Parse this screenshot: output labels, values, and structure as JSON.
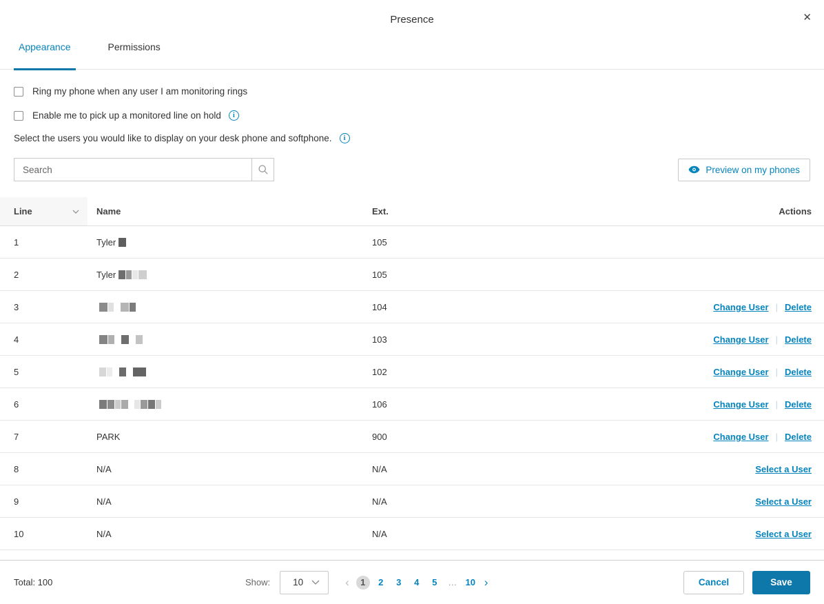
{
  "dialog": {
    "title": "Presence",
    "close_glyph": "✕"
  },
  "tabs": [
    {
      "label": "Appearance",
      "active": true
    },
    {
      "label": "Permissions",
      "active": false
    }
  ],
  "options": {
    "ring_checkbox_label": "Ring my phone when any user I am monitoring rings",
    "pickup_checkbox_label": "Enable me to pick up a monitored line on hold",
    "select_users_text": "Select the users you would like to display on your desk phone and softphone.",
    "info_glyph": "i"
  },
  "search": {
    "placeholder": "Search"
  },
  "preview_button_label": "Preview on my phones",
  "table": {
    "headers": {
      "line": "Line",
      "name": "Name",
      "ext": "Ext.",
      "actions": "Actions"
    },
    "rows": [
      {
        "line": "1",
        "name": "Tyler",
        "redaction": [
          [
            11,
            "#5f5f5f"
          ]
        ],
        "ext": "105",
        "actions": []
      },
      {
        "line": "2",
        "name": "Tyler",
        "redaction": [
          [
            10,
            "#6e6e6e"
          ],
          [
            8,
            "#9a9a9a"
          ],
          [
            8,
            "#e8e8e8"
          ],
          [
            12,
            "#cfcfcf"
          ]
        ],
        "ext": "105",
        "actions": []
      },
      {
        "line": "3",
        "name": "",
        "redaction": [
          [
            12,
            "#8b8b8b"
          ],
          [
            8,
            "#e0e0e0"
          ],
          [
            8,
            ""
          ],
          [
            12,
            "#b5b5b5"
          ],
          [
            9,
            "#7c7c7c"
          ]
        ],
        "ext": "104",
        "actions": [
          "Change User",
          "Delete"
        ]
      },
      {
        "line": "4",
        "name": "",
        "redaction": [
          [
            12,
            "#848484"
          ],
          [
            9,
            "#b0b0b0"
          ],
          [
            8,
            ""
          ],
          [
            11,
            "#6e6e6e"
          ],
          [
            8,
            ""
          ],
          [
            10,
            "#c3c3c3"
          ]
        ],
        "ext": "103",
        "actions": [
          "Change User",
          "Delete"
        ]
      },
      {
        "line": "5",
        "name": "",
        "redaction": [
          [
            10,
            "#d7d7d7"
          ],
          [
            8,
            "#ececec"
          ],
          [
            8,
            ""
          ],
          [
            10,
            "#6b6b6b"
          ],
          [
            8,
            ""
          ],
          [
            19,
            "#646464"
          ]
        ],
        "ext": "102",
        "actions": [
          "Change User",
          "Delete"
        ]
      },
      {
        "line": "6",
        "name": "",
        "redaction": [
          [
            11,
            "#7b7b7b"
          ],
          [
            10,
            "#8b8b8b"
          ],
          [
            8,
            "#cccccc"
          ],
          [
            10,
            "#ababab"
          ],
          [
            7,
            ""
          ],
          [
            8,
            "#e6e6e6"
          ],
          [
            10,
            "#9a9a9a"
          ],
          [
            10,
            "#777777"
          ],
          [
            8,
            "#cccccc"
          ]
        ],
        "ext": "106",
        "actions": [
          "Change User",
          "Delete"
        ]
      },
      {
        "line": "7",
        "name": "PARK",
        "redaction": [],
        "ext": "900",
        "actions": [
          "Change User",
          "Delete"
        ]
      },
      {
        "line": "8",
        "name": "N/A",
        "redaction": [],
        "ext": "N/A",
        "actions": [
          "Select a User"
        ]
      },
      {
        "line": "9",
        "name": "N/A",
        "redaction": [],
        "ext": "N/A",
        "actions": [
          "Select a User"
        ]
      },
      {
        "line": "10",
        "name": "N/A",
        "redaction": [],
        "ext": "N/A",
        "actions": [
          "Select a User"
        ]
      }
    ]
  },
  "footer": {
    "total": "Total: 100",
    "show_label": "Show:",
    "page_size": "10",
    "pagination": {
      "prev": "‹",
      "next": "›",
      "pages": [
        "1",
        "2",
        "3",
        "4",
        "5",
        "…",
        "10"
      ],
      "current": "1"
    },
    "cancel_label": "Cancel",
    "save_label": "Save"
  },
  "colors": {
    "accent": "#0684bd",
    "save_bg": "#0f78ab",
    "current_page_bg": "#d9d9d9"
  }
}
